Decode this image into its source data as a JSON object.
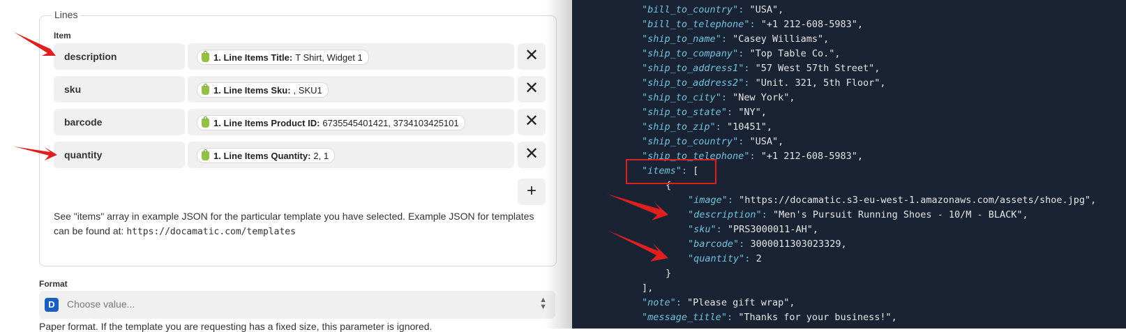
{
  "left_panel": {
    "lines_legend": "Lines",
    "item_label": "Item",
    "rows": [
      {
        "key": "description",
        "pill_bold": "1. Line Items Title:",
        "pill_value": "T Shirt, Widget 1"
      },
      {
        "key": "sku",
        "pill_bold": "1. Line Items Sku:",
        "pill_value": ", SKU1"
      },
      {
        "key": "barcode",
        "pill_bold": "1. Line Items Product ID:",
        "pill_value": "6735545401421, 3734103425101"
      },
      {
        "key": "quantity",
        "pill_bold": "1. Line Items Quantity:",
        "pill_value": "2, 1"
      }
    ],
    "remove_glyph": "✕",
    "add_glyph": "+",
    "help_text": "See \"items\" array in example JSON for the particular template you have selected. Example JSON for templates can be found at: ",
    "help_link": "https://docamatic.com/templates",
    "format_label": "Format",
    "format_placeholder": "Choose value...",
    "format_icon_letter": "D",
    "format_help_cut": "Paper format. If the template you are requesting has a fixed size, this parameter is ignored."
  },
  "json_lines": [
    {
      "key": "bill_to_country",
      "value": "\"USA\","
    },
    {
      "key": "bill_to_telephone",
      "value": "\"+1 212-608-5983\","
    },
    {
      "key": "ship_to_name",
      "value": "\"Casey Williams\","
    },
    {
      "key": "ship_to_company",
      "value": "\"Top Table Co.\","
    },
    {
      "key": "ship_to_address1",
      "value": "\"57 West 57th Street\","
    },
    {
      "key": "ship_to_address2",
      "value": "\"Unit. 321, 5th Floor\","
    },
    {
      "key": "ship_to_city",
      "value": "\"New York\","
    },
    {
      "key": "ship_to_state",
      "value": "\"NY\","
    },
    {
      "key": "ship_to_zip",
      "value": "\"10451\","
    },
    {
      "key": "ship_to_country",
      "value": "\"USA\","
    },
    {
      "key": "ship_to_telephone",
      "value": "\"+1 212-608-5983\","
    },
    {
      "key": "items",
      "value": "["
    },
    {
      "key": "",
      "value": "{"
    },
    {
      "key": "image",
      "value": "\"https://docamatic.s3-eu-west-1.amazonaws.com/assets/shoe.jpg\","
    },
    {
      "key": "description",
      "value": "\"Men's Pursuit Running Shoes - 10/M - BLACK\","
    },
    {
      "key": "sku",
      "value": "\"PRS3000011-AH\","
    },
    {
      "key": "barcode",
      "value": "3000011303023329,"
    },
    {
      "key": "quantity",
      "value": "2"
    },
    {
      "key": "",
      "value": "}"
    },
    {
      "key": "",
      "value": "],"
    },
    {
      "key": "note",
      "value": "\"Please gift wrap\","
    },
    {
      "key": "message_title",
      "value": "\"Thanks for your business!\","
    }
  ],
  "colors": {
    "annotation_red": "#e02020",
    "json_key": "#6fc3df",
    "code_background": "#1a2333"
  }
}
